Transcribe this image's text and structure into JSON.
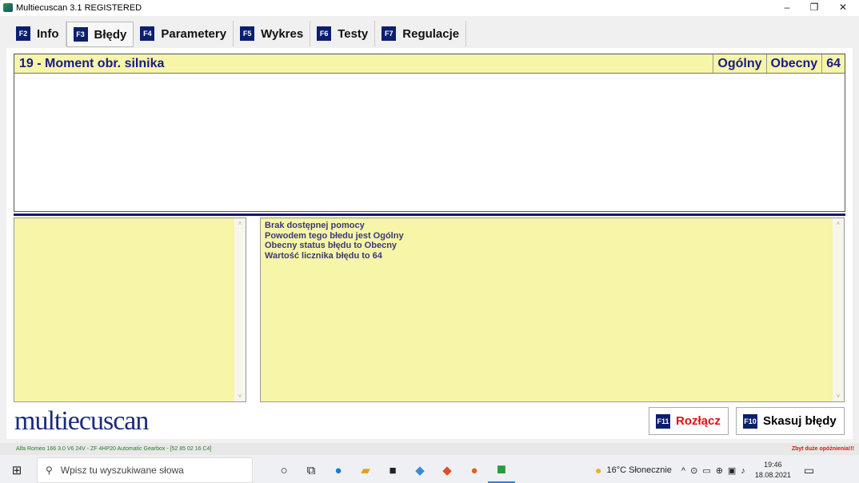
{
  "window": {
    "title": "Multiecuscan 3.1 REGISTERED",
    "minimize": "–",
    "restore": "❐",
    "close": "✕"
  },
  "tabs": [
    {
      "key": "F2",
      "label": "Info"
    },
    {
      "key": "F3",
      "label": "Błędy",
      "active": true
    },
    {
      "key": "F4",
      "label": "Parametery"
    },
    {
      "key": "F5",
      "label": "Wykres"
    },
    {
      "key": "F6",
      "label": "Testy"
    },
    {
      "key": "F7",
      "label": "Regulacje"
    }
  ],
  "fault": {
    "name": "19 - Moment obr. silnika",
    "type": "Ogólny",
    "status": "Obecny",
    "count": "64"
  },
  "help": [
    "Brak dostępnej pomocy",
    "Powodem tego błedu jest Ogólny",
    "Obecny status błędu to Obecny",
    "Wartość licznika błędu to 64"
  ],
  "logo": "multiecuscan",
  "buttons": {
    "disconnect": {
      "key": "F11",
      "label": "Rozłącz",
      "color": "#e01010"
    },
    "clear": {
      "key": "F10",
      "label": "Skasuj błędy"
    }
  },
  "status": {
    "vehicle": "Alfa Romeo 166 3.0 V6 24V - ZF 4HP20 Automatic Gearbox - [52 85 02 16 C4]",
    "warning": "Zbyt duże opóźnienia!!!"
  },
  "taskbar": {
    "search_placeholder": "Wpisz tu wyszukiwane słowa",
    "weather": "16°C  Słonecznie",
    "time": "19:46",
    "date": "18.08.2021"
  }
}
